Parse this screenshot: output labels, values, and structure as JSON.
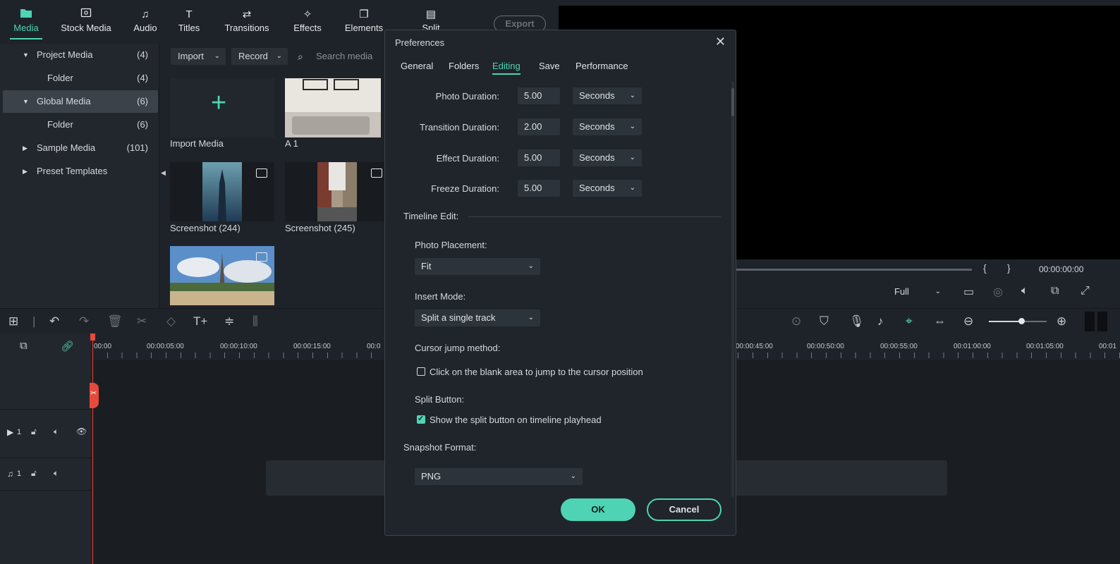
{
  "nav": {
    "tabs": [
      {
        "label": "Media",
        "icon": "folder-icon"
      },
      {
        "label": "Stock Media",
        "icon": "stock-media-icon"
      },
      {
        "label": "Audio",
        "icon": "music-note-icon"
      },
      {
        "label": "Titles",
        "icon": "text-icon"
      },
      {
        "label": "Transitions",
        "icon": "transition-icon"
      },
      {
        "label": "Effects",
        "icon": "effects-icon"
      },
      {
        "label": "Elements",
        "icon": "elements-icon"
      },
      {
        "label": "Split Screen",
        "icon": "split-screen-icon"
      }
    ],
    "export_label": "Export"
  },
  "library": {
    "items": [
      {
        "label": "Project Media",
        "count": "(4)"
      },
      {
        "label": "Folder",
        "count": "(4)"
      },
      {
        "label": "Global Media",
        "count": "(6)"
      },
      {
        "label": "Folder",
        "count": "(6)"
      },
      {
        "label": "Sample Media",
        "count": "(101)"
      },
      {
        "label": "Preset Templates",
        "count": ""
      }
    ]
  },
  "media_toolbar": {
    "import_label": "Import",
    "record_label": "Record",
    "search_placeholder": "Search media"
  },
  "media_items": [
    {
      "label": "Import Media"
    },
    {
      "label": "A 1"
    },
    {
      "label": "Screenshot (244)"
    },
    {
      "label": "Screenshot (245)"
    },
    {
      "label": ""
    }
  ],
  "preview": {
    "timecode": "00:00:00:00",
    "quality": "Full"
  },
  "timeline": {
    "ticks": [
      "00:00",
      "00:00:05:00",
      "00:00:10:00",
      "00:00:15:00",
      "00:0",
      "00:00:45:00",
      "00:00:50:00",
      "00:00:55:00",
      "00:01:00:00",
      "00:01:05:00",
      "00:01"
    ],
    "video_track": "1",
    "audio_track": "1"
  },
  "dialog": {
    "title": "Preferences",
    "tabs": [
      "General",
      "Folders",
      "Editing",
      "Save",
      "Performance"
    ],
    "active_tab": "Editing",
    "durations": [
      {
        "label": "Photo Duration:",
        "value": "5.00",
        "unit": "Seconds"
      },
      {
        "label": "Transition Duration:",
        "value": "2.00",
        "unit": "Seconds"
      },
      {
        "label": "Effect Duration:",
        "value": "5.00",
        "unit": "Seconds"
      },
      {
        "label": "Freeze Duration:",
        "value": "5.00",
        "unit": "Seconds"
      }
    ],
    "timeline_edit_label": "Timeline Edit:",
    "photo_placement_label": "Photo Placement:",
    "photo_placement_value": "Fit",
    "insert_mode_label": "Insert Mode:",
    "insert_mode_value": "Split a single track",
    "cursor_jump_label": "Cursor jump method:",
    "cursor_jump_option": "Click on the blank area to jump to the cursor position",
    "cursor_jump_checked": false,
    "split_button_label": "Split Button:",
    "split_button_option": "Show the split button on timeline playhead",
    "split_button_checked": true,
    "snapshot_label": "Snapshot Format:",
    "snapshot_value": "PNG",
    "ok_label": "OK",
    "cancel_label": "Cancel"
  },
  "colors": {
    "accent": "#4fd3b5",
    "playhead": "#e64a3c",
    "background": "#1e2329"
  }
}
